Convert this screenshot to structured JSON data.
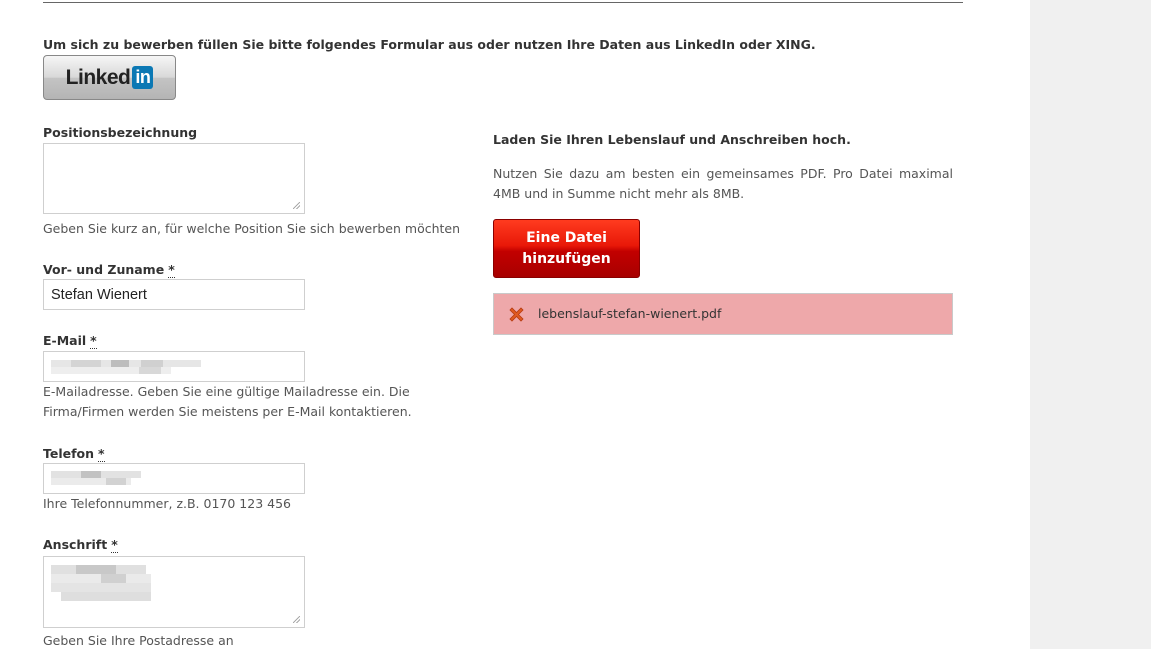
{
  "intro_text": "Um sich zu bewerben füllen Sie bitte folgendes Formular aus oder nutzen Ihre Daten aus LinkedIn oder XING.",
  "linkedin": {
    "word": "Linked",
    "in": "in"
  },
  "fields": {
    "position": {
      "label": "Positionsbezeichnung",
      "value": "",
      "help": "Geben Sie kurz an, für welche Position Sie sich bewerben möchten"
    },
    "name": {
      "label": "Vor- und Zuname",
      "required_mark": "*",
      "value": "Stefan Wienert"
    },
    "email": {
      "label": "E-Mail",
      "required_mark": "*",
      "help_line1": "E-Mailadresse. Geben Sie eine gültige Mailadresse ein. Die",
      "help_line2": "Firma/Firmen werden Sie meistens per E-Mail kontaktieren."
    },
    "phone": {
      "label": "Telefon",
      "required_mark": "*",
      "help": "Ihre Telefonnummer, z.B. 0170 123 456"
    },
    "address": {
      "label": "Anschrift",
      "required_mark": "*",
      "help": "Geben Sie Ihre Postadresse an"
    }
  },
  "upload": {
    "heading": "Laden Sie Ihren Lebenslauf und Anschreiben hoch.",
    "description": "Nutzen Sie dazu am besten ein gemeinsames PDF. Pro Datei maximal 4MB und in Summe nicht mehr als 8MB.",
    "button_line1": "Eine Datei",
    "button_line2": "hinzufügen",
    "files": [
      {
        "name": "lebenslauf-stefan-wienert.pdf",
        "status_color": "#eea8aa"
      }
    ]
  },
  "icons": {
    "remove": "remove-x-icon",
    "linkedin": "linkedin-logo"
  }
}
